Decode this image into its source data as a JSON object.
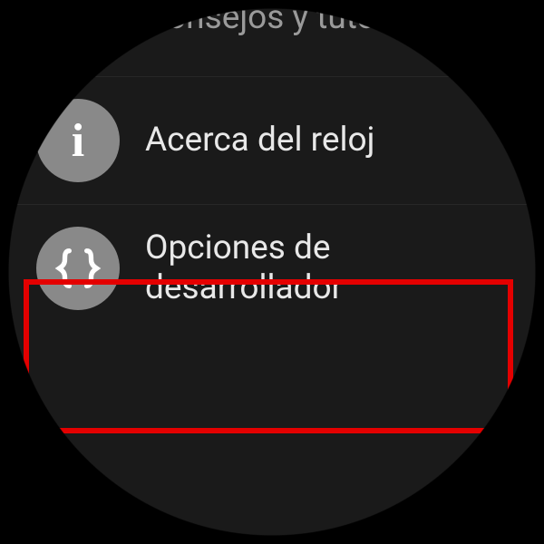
{
  "menu": {
    "items": [
      {
        "label": "Consejos y tutoriales",
        "icon": "tips"
      },
      {
        "label": "Acerca del reloj",
        "icon": "info"
      },
      {
        "label": "Opciones de desarrollador",
        "icon": "braces"
      }
    ]
  },
  "highlight_index": 2,
  "colors": {
    "tips_bg": "#d68a1f",
    "icon_bg": "#898989",
    "highlight": "#e40000"
  }
}
